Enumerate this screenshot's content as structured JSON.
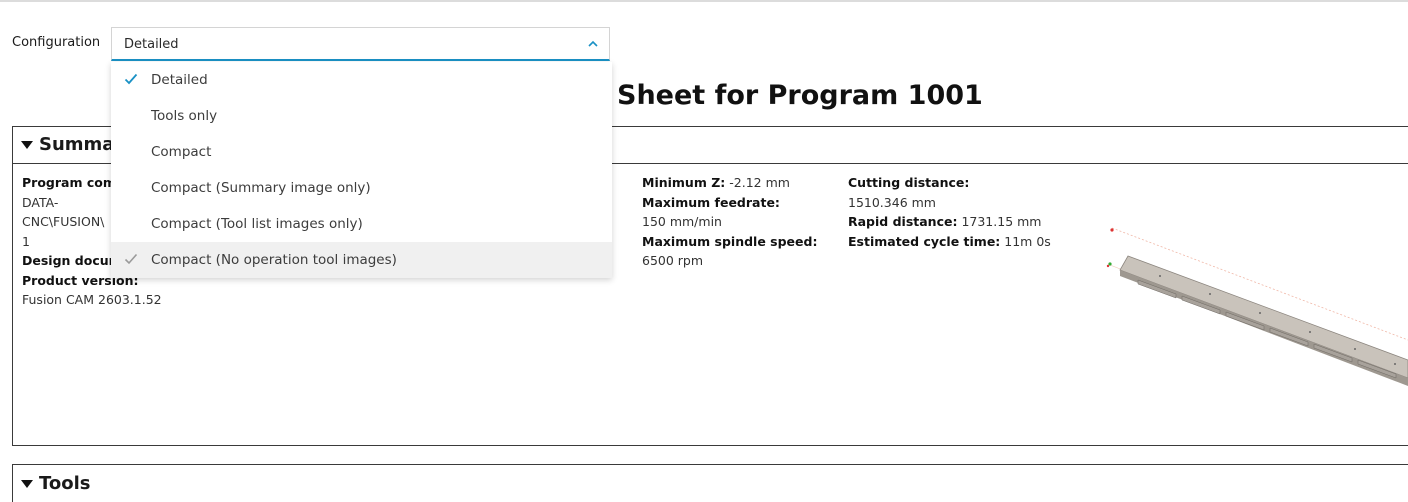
{
  "config": {
    "label": "Configuration",
    "selected": "Detailed",
    "options": [
      {
        "label": "Detailed",
        "checked": true
      },
      {
        "label": "Tools only",
        "checked": false
      },
      {
        "label": "Compact",
        "checked": false
      },
      {
        "label": "Compact (Summary image only)",
        "checked": false
      },
      {
        "label": "Compact (Tool list images only)",
        "checked": false
      },
      {
        "label": "Compact (No operation tool images)",
        "checked": false,
        "hover_check": true
      }
    ]
  },
  "page_title": "Sheet for Program 1001",
  "summary": {
    "title": "Summary",
    "program_comment_label": "Program comm",
    "program_comment_lines": [
      "DATA-",
      "CNC\\FUSION\\",
      "1"
    ],
    "design_document_label": "Design docum",
    "product_version_label": "Product version:",
    "product_version_value": "Fusion CAM 2603.1.52",
    "min_z_label": "Minimum Z:",
    "min_z_value": "-2.12 mm",
    "max_feed_label": "Maximum feedrate:",
    "max_feed_value": "150 mm/min",
    "max_spindle_label": "Maximum spindle speed:",
    "max_spindle_value": "6500 rpm",
    "cutting_label": "Cutting distance:",
    "cutting_value": "1510.346 mm",
    "rapid_label": "Rapid distance:",
    "rapid_value": "1731.15 mm",
    "cycle_label": "Estimated cycle time:",
    "cycle_value": "11m 0s"
  },
  "tools": {
    "title": "Tools"
  },
  "colors": {
    "accent": "#1a91c5",
    "border": "#3a3a3a"
  }
}
